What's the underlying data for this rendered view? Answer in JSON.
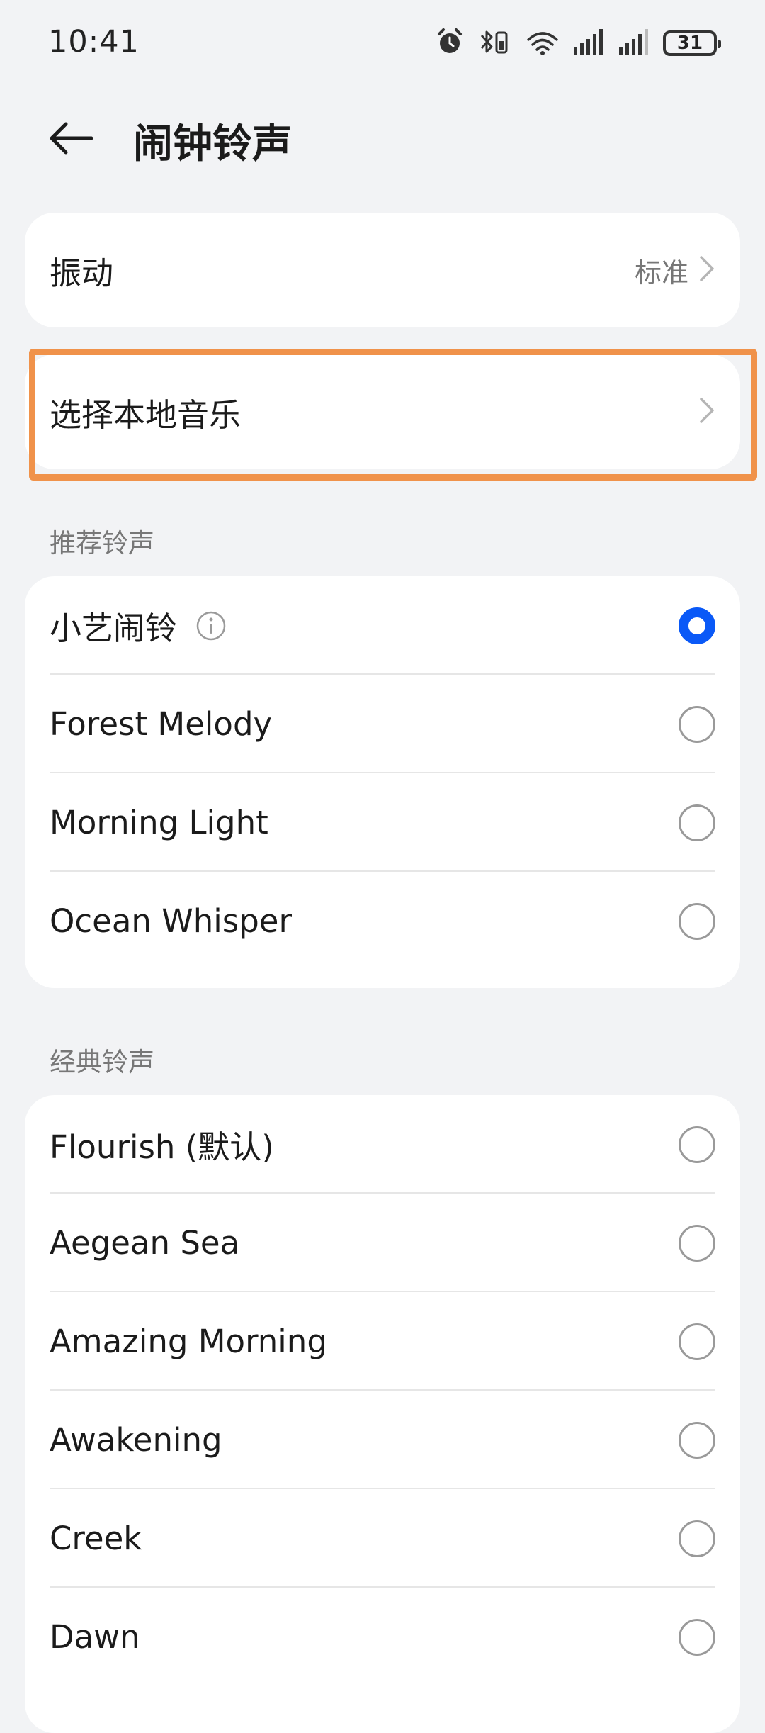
{
  "status_bar": {
    "time": "10:41",
    "battery": "31",
    "icons": [
      "alarm-icon",
      "bluetooth-icon",
      "wifi-icon",
      "signal-icon",
      "signal-icon",
      "battery-icon"
    ]
  },
  "header": {
    "back_icon": "back-arrow-icon",
    "title": "闹钟铃声"
  },
  "vibration": {
    "label": "振动",
    "value": "标准"
  },
  "local_music": {
    "label": "选择本地音乐"
  },
  "recommended": {
    "section_title": "推荐铃声",
    "items": [
      {
        "label": "小艺闹铃",
        "selected": true,
        "has_info": true
      },
      {
        "label": "Forest Melody",
        "selected": false
      },
      {
        "label": "Morning Light",
        "selected": false
      },
      {
        "label": "Ocean Whisper",
        "selected": false
      }
    ]
  },
  "classic": {
    "section_title": "经典铃声",
    "items": [
      {
        "label": "Flourish (默认)",
        "selected": false
      },
      {
        "label": "Aegean Sea",
        "selected": false
      },
      {
        "label": "Amazing Morning",
        "selected": false
      },
      {
        "label": "Awakening",
        "selected": false
      },
      {
        "label": "Creek",
        "selected": false
      },
      {
        "label": "Dawn",
        "selected": false
      }
    ]
  },
  "colors": {
    "accent": "#0a59f7",
    "highlight": "#f0924a",
    "background": "#f2f3f5"
  }
}
